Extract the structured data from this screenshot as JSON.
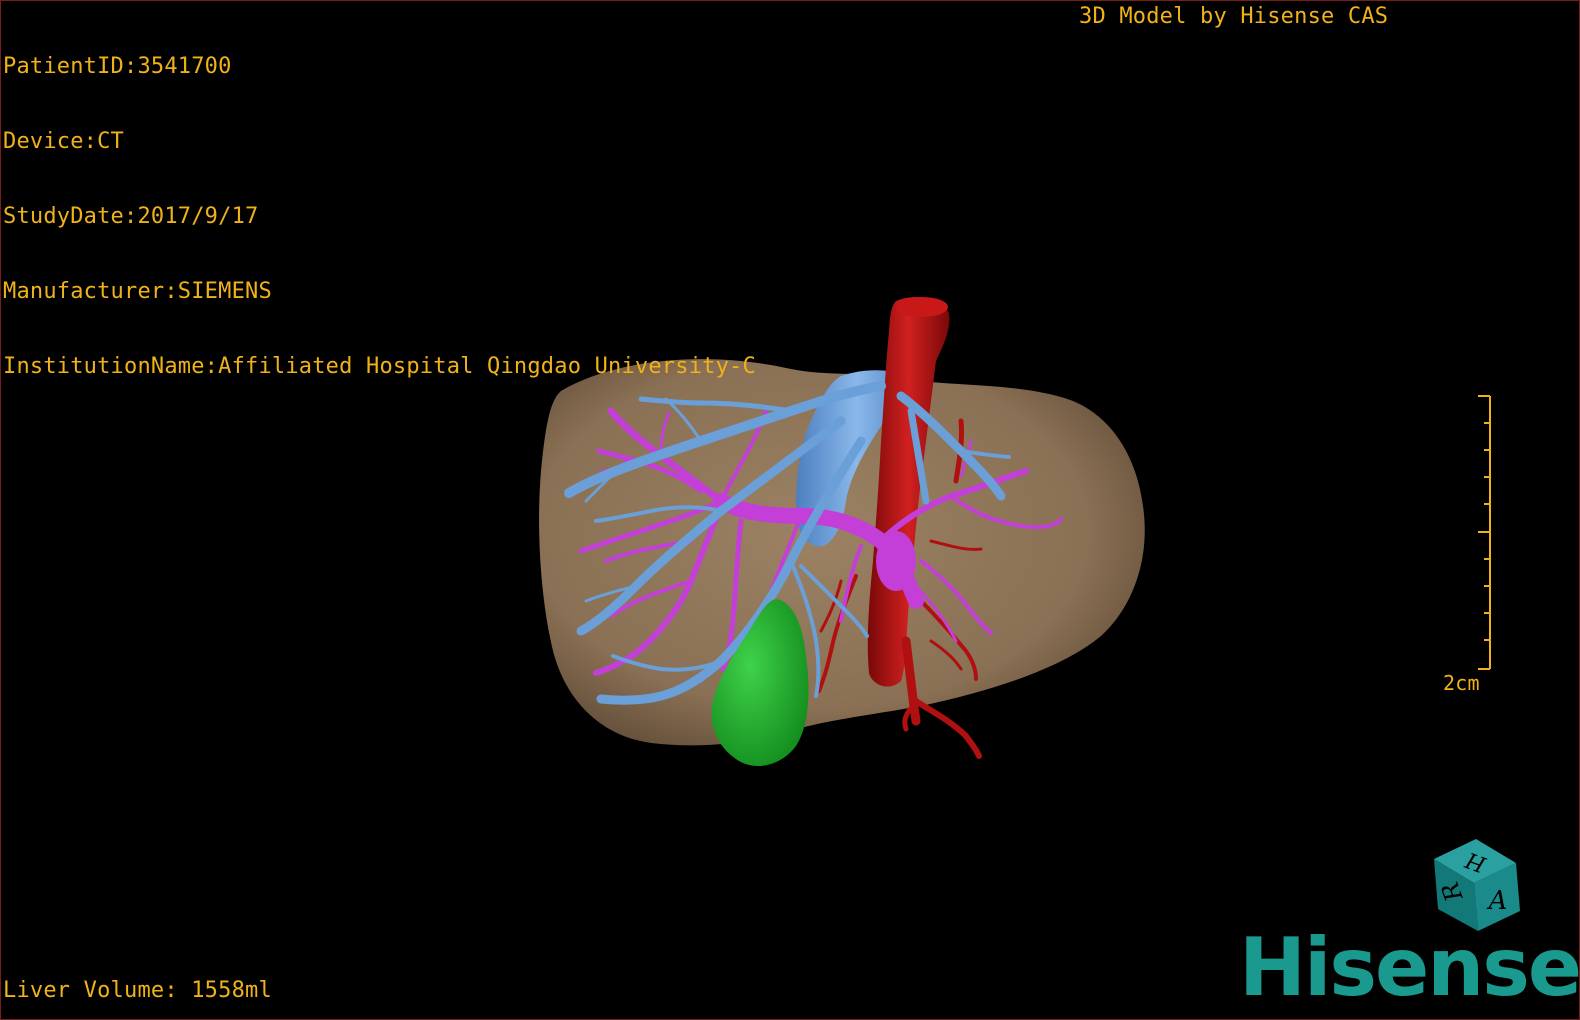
{
  "overlay": {
    "patient_line": "PatientID:3541700",
    "device_line": "Device:CT",
    "study_line": "StudyDate:2017/9/17",
    "manufacturer_line": "Manufacturer:SIEMENS",
    "institution_line": "InstitutionName:Affiliated Hospital Qingdao University-C",
    "model_credit": "3D Model by Hisense CAS",
    "liver_volume_line": "Liver Volume: 1558ml",
    "scale_label": "2cm"
  },
  "orientation_cube": {
    "face_top": "H",
    "face_left": "R",
    "face_right": "A",
    "color": "#1a8a8a"
  },
  "brand": {
    "name": "Hisense",
    "color": "#1a9a8e"
  },
  "colors": {
    "overlay_text": "#f0b21a",
    "liver": "#8c7357",
    "hepatic_vein": "#6a9fd8",
    "portal_vein": "#c43fd8",
    "artery": "#b01010",
    "gallbladder": "#1fa82a",
    "frame": "#7a1d1d"
  },
  "icons": [
    "orientation-cube-icon",
    "scale-bar-icon",
    "hisense-logo"
  ]
}
